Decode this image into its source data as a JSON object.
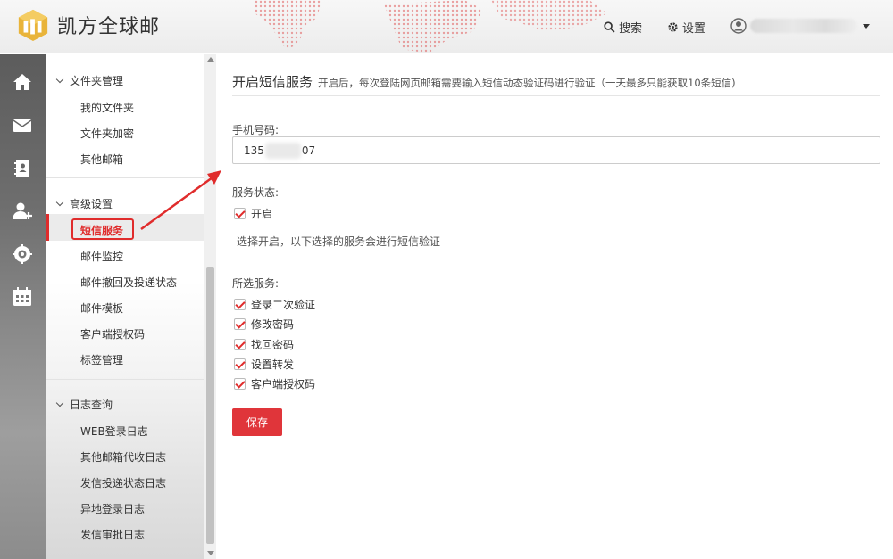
{
  "app": {
    "name": "凯方全球邮",
    "header": {
      "search_label": "搜索",
      "settings_label": "设置"
    }
  },
  "rail": {
    "icons": [
      "home-icon",
      "mail-icon",
      "contacts-icon",
      "add-user-icon",
      "target-icon",
      "calendar-icon"
    ]
  },
  "nav": {
    "groups": [
      {
        "label": "文件夹管理",
        "items": [
          "我的文件夹",
          "文件夹加密",
          "其他邮箱"
        ]
      },
      {
        "label": "高级设置",
        "items": [
          "短信服务",
          "邮件监控",
          "邮件撤回及投递状态",
          "邮件模板",
          "客户端授权码",
          "标签管理"
        ]
      },
      {
        "label": "日志查询",
        "items": [
          "WEB登录日志",
          "其他邮箱代收日志",
          "发信投递状态日志",
          "异地登录日志",
          "发信审批日志"
        ]
      }
    ],
    "active_item": "短信服务"
  },
  "main": {
    "title": "开启短信服务",
    "description": "开启后，每次登陆网页邮箱需要输入短信动态验证码进行验证（一天最多只能获取10条短信)",
    "phone_label": "手机号码:",
    "phone_prefix": "135",
    "phone_suffix": "07",
    "status_label": "服务状态:",
    "status_option": "开启",
    "status_checked": true,
    "hint": "选择开启，以下选择的服务会进行短信验证",
    "services_label": "所选服务:",
    "services": [
      {
        "label": "登录二次验证",
        "checked": true
      },
      {
        "label": "修改密码",
        "checked": true
      },
      {
        "label": "找回密码",
        "checked": true
      },
      {
        "label": "设置转发",
        "checked": true
      },
      {
        "label": "客户端授权码",
        "checked": true
      }
    ],
    "save_label": "保存"
  },
  "colors": {
    "accent": "#e0353a",
    "highlight": "#e02c2c"
  }
}
